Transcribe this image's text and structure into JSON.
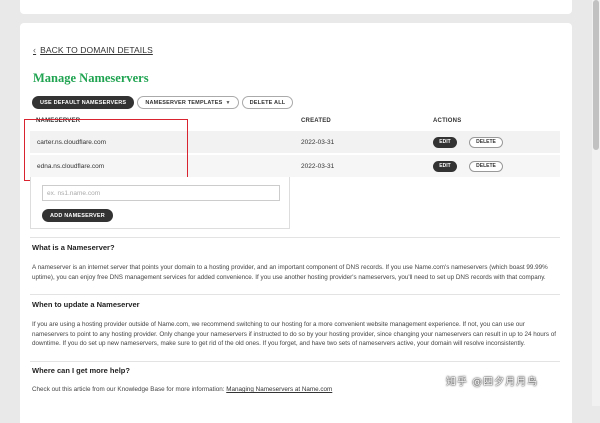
{
  "back_link": {
    "label": "BACK TO DOMAIN DETAILS"
  },
  "page_title": "Manage Nameservers",
  "toolbar": {
    "use_default": "USE DEFAULT NAMESERVERS",
    "templates": "NAMESERVER TEMPLATES",
    "delete_all": "DELETE ALL"
  },
  "table": {
    "headers": {
      "nameserver": "NAMESERVER",
      "created": "CREATED",
      "actions": "ACTIONS"
    },
    "rows": [
      {
        "nameserver": "carter.ns.cloudflare.com",
        "created": "2022-03-31",
        "edit": "EDIT",
        "delete": "DELETE"
      },
      {
        "nameserver": "edna.ns.cloudflare.com",
        "created": "2022-03-31",
        "edit": "EDIT",
        "delete": "DELETE"
      }
    ]
  },
  "add_form": {
    "placeholder": "ex. ns1.name.com",
    "button": "ADD NAMESERVER"
  },
  "sections": [
    {
      "title": "What is a Nameserver?",
      "text": "A nameserver is an internet server that points your domain to a hosting provider, and an important component of DNS records. If you use Name.com's nameservers (which boast 99.99% uptime), you can enjoy free DNS management services for added convenience. If you use another hosting provider's nameservers, you'll need to set up DNS records with that company."
    },
    {
      "title": "When to update a Nameserver",
      "text": "If you are using a hosting provider outside of Name.com, we recommend switching to our hosting for a more convenient website management experience. If not, you can use our nameservers to point to any hosting provider. Only change your nameservers if instructed to do so by your hosting provider, since changing your nameservers can result in up to 24 hours of downtime. If you do set up new nameservers, make sure to get rid of the old ones. If you forget, and have two sets of nameservers active, your domain will resolve inconsistently."
    },
    {
      "title": "Where can I get more help?",
      "text": "Check out this article from our Knowledge Base for more information: ",
      "link": "Managing Nameservers at Name.com"
    }
  ],
  "watermark": "知乎 @四夕月月鸟",
  "colors": {
    "title_green": "#21a452",
    "highlight_red": "#d9232e",
    "dark_button": "#333333"
  }
}
